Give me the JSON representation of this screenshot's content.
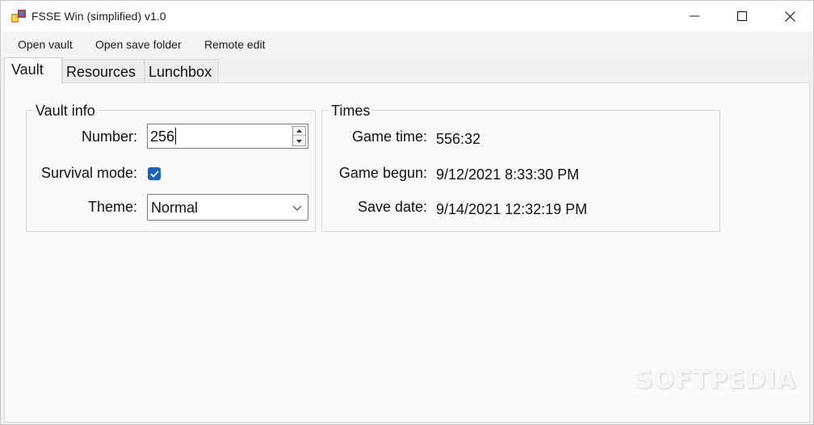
{
  "window": {
    "title": "FSSE Win (simplified) v1.0",
    "controls": {
      "minimize": "minimize",
      "maximize": "maximize",
      "close": "close"
    }
  },
  "menu": {
    "items": [
      "Open vault",
      "Open save folder",
      "Remote edit"
    ]
  },
  "tabs": {
    "items": [
      "Vault",
      "Resources",
      "Lunchbox"
    ],
    "active": "Vault"
  },
  "vault_info": {
    "title": "Vault info",
    "number_label": "Number:",
    "number_value": "256",
    "survival_label": "Survival mode:",
    "survival_checked": true,
    "theme_label": "Theme:",
    "theme_value": "Normal"
  },
  "times": {
    "title": "Times",
    "rows": [
      {
        "label": "Game time:",
        "value": "556:32"
      },
      {
        "label": "Game begun:",
        "value": "9/12/2021 8:33:30 PM"
      },
      {
        "label": "Save date:",
        "value": "9/14/2021 12:32:19 PM"
      }
    ]
  },
  "watermark": "SOFTPEDIA",
  "colors": {
    "accent": "#1565c0",
    "background": "#f0f0f0",
    "tab_page": "#fafafa"
  },
  "icons": [
    "app-icon",
    "minimize-icon",
    "maximize-icon",
    "close-icon",
    "spin-up-icon",
    "spin-down-icon",
    "checkmark-icon",
    "chevron-down-icon"
  ]
}
